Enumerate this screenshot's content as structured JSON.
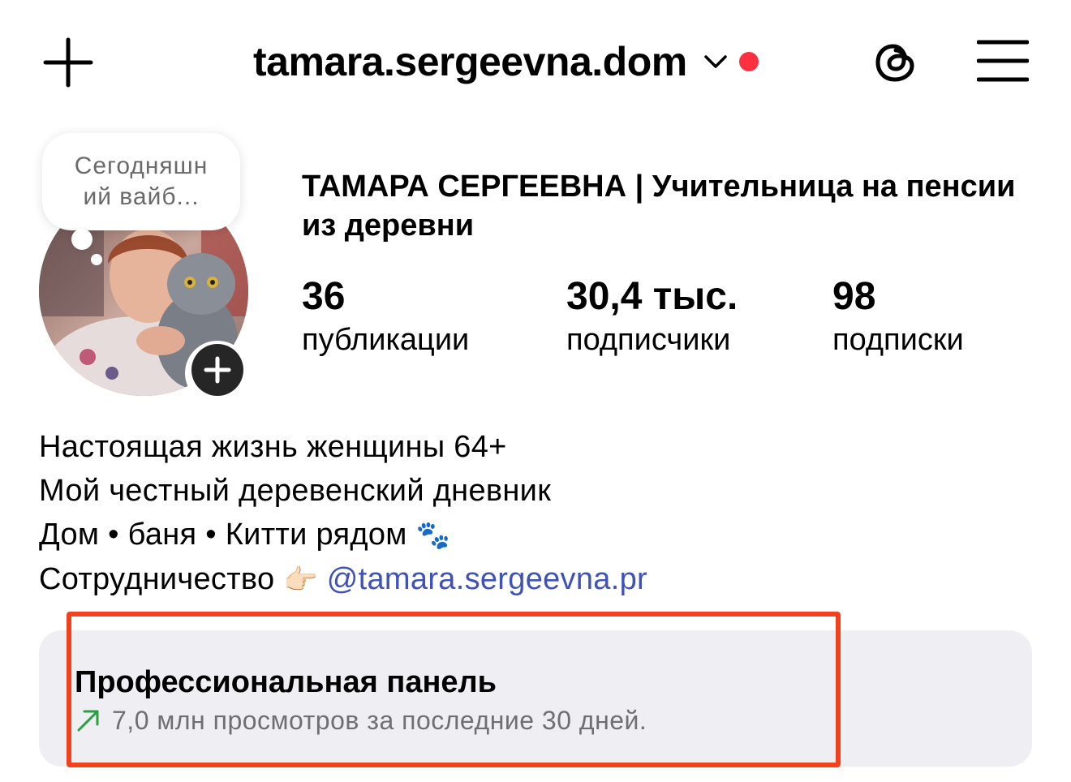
{
  "header": {
    "username": "tamara.sergeevna.dom",
    "has_notification_dot": true
  },
  "note": {
    "text": "Сегодняшн ий вайб..."
  },
  "profile": {
    "full_name": "ТАМАРА СЕРГЕЕВНА | Учительница на пенсии из деревни",
    "stats": {
      "posts": {
        "count": "36",
        "label": "публикации"
      },
      "followers": {
        "count": "30,4 тыс.",
        "label": "подписчики"
      },
      "following": {
        "count": "98",
        "label": "подписки"
      }
    }
  },
  "bio": {
    "line1": "Настоящая жизнь женщины 64+",
    "line2": "Мой честный деревенский дневник",
    "line3": "Дом • баня • Китти рядом",
    "line3_emoji": "🐾",
    "line4_prefix": "Сотрудничество",
    "line4_emoji": "👉🏻",
    "line4_link": "@tamara.sergeevna.pr"
  },
  "professional_dashboard": {
    "title": "Профессиональная панель",
    "subtitle": "7,0 млн просмотров за последние 30 дней."
  },
  "colors": {
    "link": "#3f52b5",
    "notification_dot": "#ff3040",
    "highlight": "#f2411c",
    "panel_bg": "#efeff3",
    "trend_arrow": "#2e9e44"
  },
  "icons": [
    "plus-icon",
    "chevron-down-icon",
    "threads-icon",
    "menu-icon",
    "add-story-icon",
    "trend-up-icon"
  ]
}
